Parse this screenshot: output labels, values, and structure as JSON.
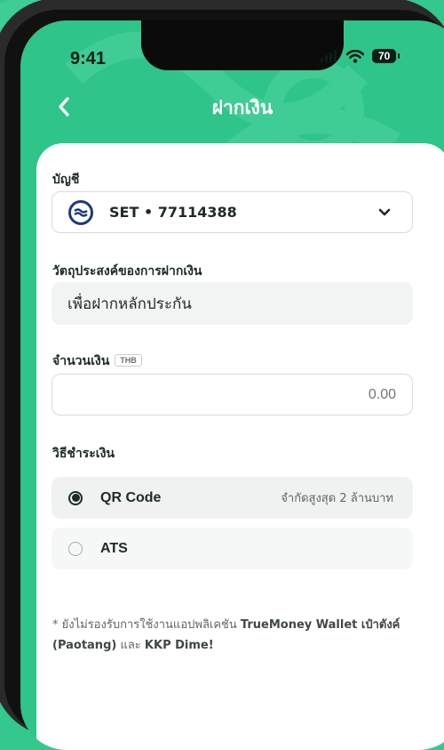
{
  "status_bar": {
    "time": "9:41",
    "battery": "70"
  },
  "header": {
    "title": "ฝากเงิน"
  },
  "account": {
    "label": "บัญชี",
    "value": "SET • 77114388"
  },
  "purpose": {
    "label": "วัตถุประสงค์ของการฝากเงิน",
    "value": "เพื่อฝากหลักประกัน"
  },
  "amount": {
    "label": "จำนวนเงิน",
    "currency": "THB",
    "placeholder": "0.00"
  },
  "payment": {
    "label": "วิธีชำระเงิน",
    "options": [
      {
        "name": "QR Code",
        "limit": "จำกัดสูงสุด 2 ล้านบาท",
        "selected": true
      },
      {
        "name": "ATS",
        "limit": "",
        "selected": false
      }
    ]
  },
  "note": {
    "prefix": "* ยังไม่รองรับการใช้งานแอปพลิเคชัน",
    "app1": "TrueMoney Wallet เป๋าตังค์ (Paotang)",
    "and": "และ",
    "app2": "KKP Dime!"
  },
  "colors": {
    "brand_green": "#35c88e",
    "account_logo": "#1e3a78"
  }
}
